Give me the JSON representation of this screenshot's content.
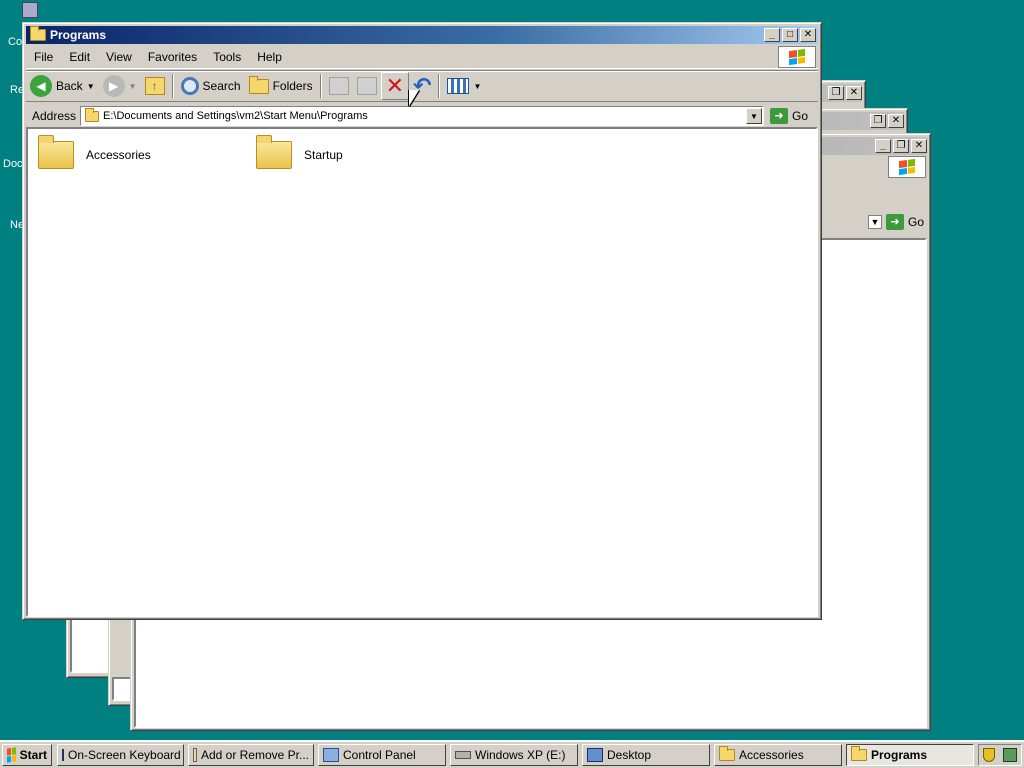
{
  "desktop": {
    "icons": [
      "Co",
      "Re",
      "Doc",
      "Ne"
    ]
  },
  "main_window": {
    "title": "Programs",
    "menu": [
      "File",
      "Edit",
      "View",
      "Favorites",
      "Tools",
      "Help"
    ],
    "toolbar": {
      "back": "Back",
      "search": "Search",
      "folders": "Folders"
    },
    "address": {
      "label": "Address",
      "value": "E:\\Documents and Settings\\vm2\\Start Menu\\Programs",
      "go": "Go"
    },
    "items": [
      {
        "name": "Accessories"
      },
      {
        "name": "Startup"
      }
    ]
  },
  "background_window": {
    "go": "Go"
  },
  "taskbar": {
    "start": "Start",
    "tasks": [
      {
        "label": "On-Screen Keyboard",
        "icon": "keyboard-icon"
      },
      {
        "label": "Add or Remove Pr...",
        "icon": "add-remove-icon"
      },
      {
        "label": "Control Panel",
        "icon": "control-panel-icon"
      },
      {
        "label": "Windows XP (E:)",
        "icon": "drive-icon"
      },
      {
        "label": "Desktop",
        "icon": "desktop-icon"
      },
      {
        "label": "Accessories",
        "icon": "folder-icon"
      },
      {
        "label": "Programs",
        "icon": "folder-icon",
        "active": true
      }
    ]
  },
  "colors": {
    "desktop": "#008080",
    "title_active": "#0a246a",
    "face": "#d4d0c8"
  }
}
